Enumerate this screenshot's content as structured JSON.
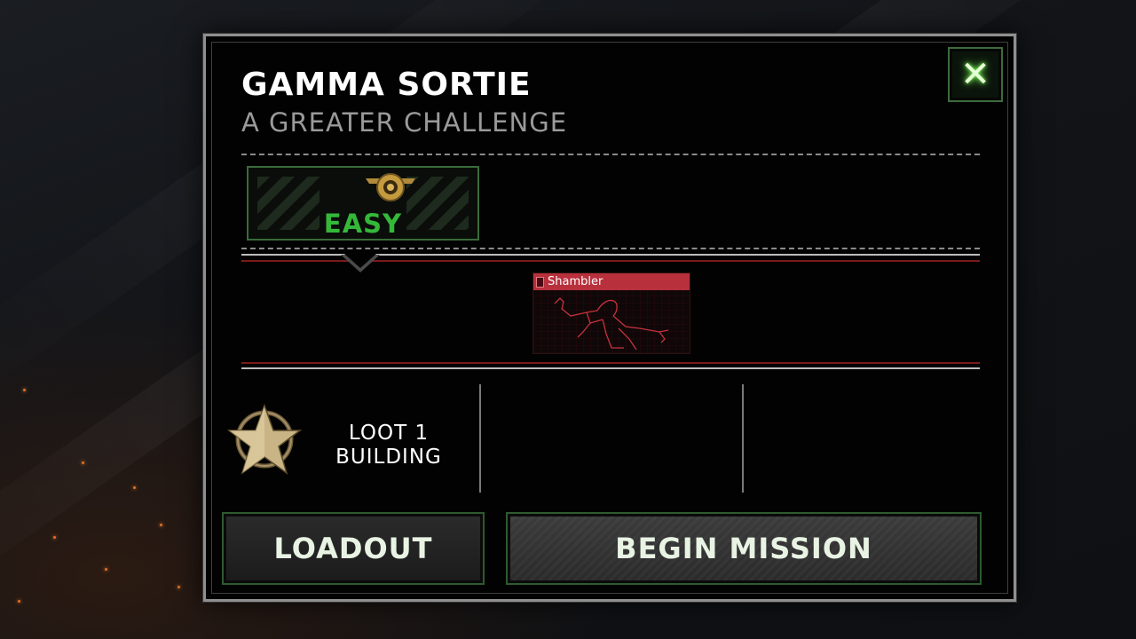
{
  "mission": {
    "title": "GAMMA SORTIE",
    "subtitle": "A GREATER CHALLENGE"
  },
  "close": {
    "icon": "close-icon",
    "glyph": "✕"
  },
  "difficulty": {
    "label": "EASY",
    "icon": "medal-icon",
    "color": "#35b83a"
  },
  "enemies": [
    {
      "name": "Shambler",
      "icon": "zombie-silhouette-icon",
      "color": "#b8303c"
    }
  ],
  "objectives": [
    {
      "icon": "star-icon",
      "text_line1": "LOOT 1",
      "text_line2": "BUILDING"
    }
  ],
  "buttons": {
    "loadout": "LOADOUT",
    "begin": "BEGIN MISSION"
  },
  "colors": {
    "accent_green": "#3a6b3a",
    "enemy_red": "#b8303c",
    "divider_red": "#7a1a1a"
  }
}
